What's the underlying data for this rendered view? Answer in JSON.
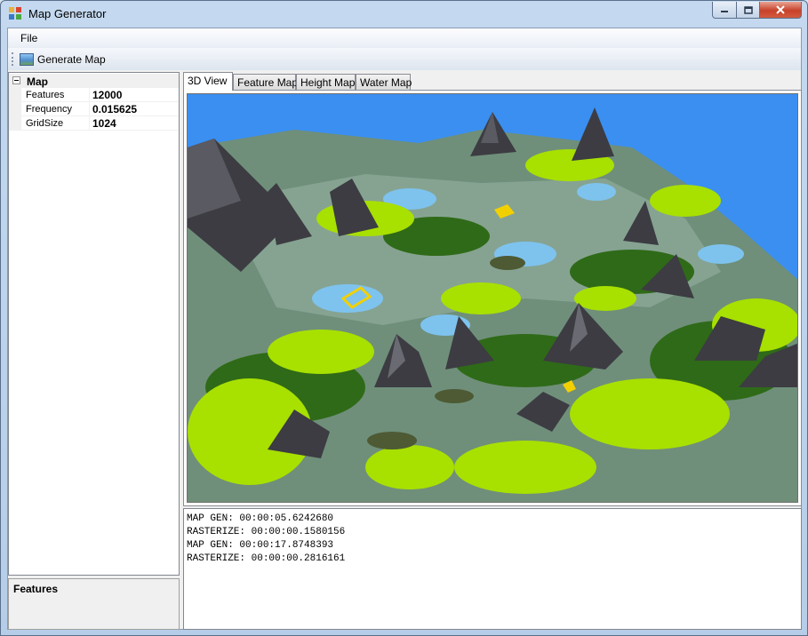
{
  "window": {
    "title": "Map Generator"
  },
  "menu": {
    "file_label": "File"
  },
  "toolbar": {
    "generate_label": "Generate Map"
  },
  "property_grid": {
    "category": "Map",
    "rows": [
      {
        "name": "Features",
        "value": "12000"
      },
      {
        "name": "Frequency",
        "value": "0.015625"
      },
      {
        "name": "GridSize",
        "value": "1024"
      }
    ]
  },
  "help_panel": {
    "title": "Features"
  },
  "tabs": [
    {
      "label": "3D View",
      "active": true
    },
    {
      "label": "Feature Map",
      "active": false
    },
    {
      "label": "Height Map",
      "active": false
    },
    {
      "label": "Water Map",
      "active": false
    }
  ],
  "log_lines": [
    "MAP GEN: 00:00:05.6242680",
    "RASTERIZE: 00:00:00.1580156",
    "MAP GEN: 00:00:17.8748393",
    "RASTERIZE: 00:00:00.2816161"
  ],
  "colors": {
    "sky": "#3a8ff1",
    "ground": "#6f8f7a",
    "grass": "#a8e000",
    "forest": "#2f6a18",
    "water": "#7ec3ee",
    "rock": "#3c3c42"
  }
}
